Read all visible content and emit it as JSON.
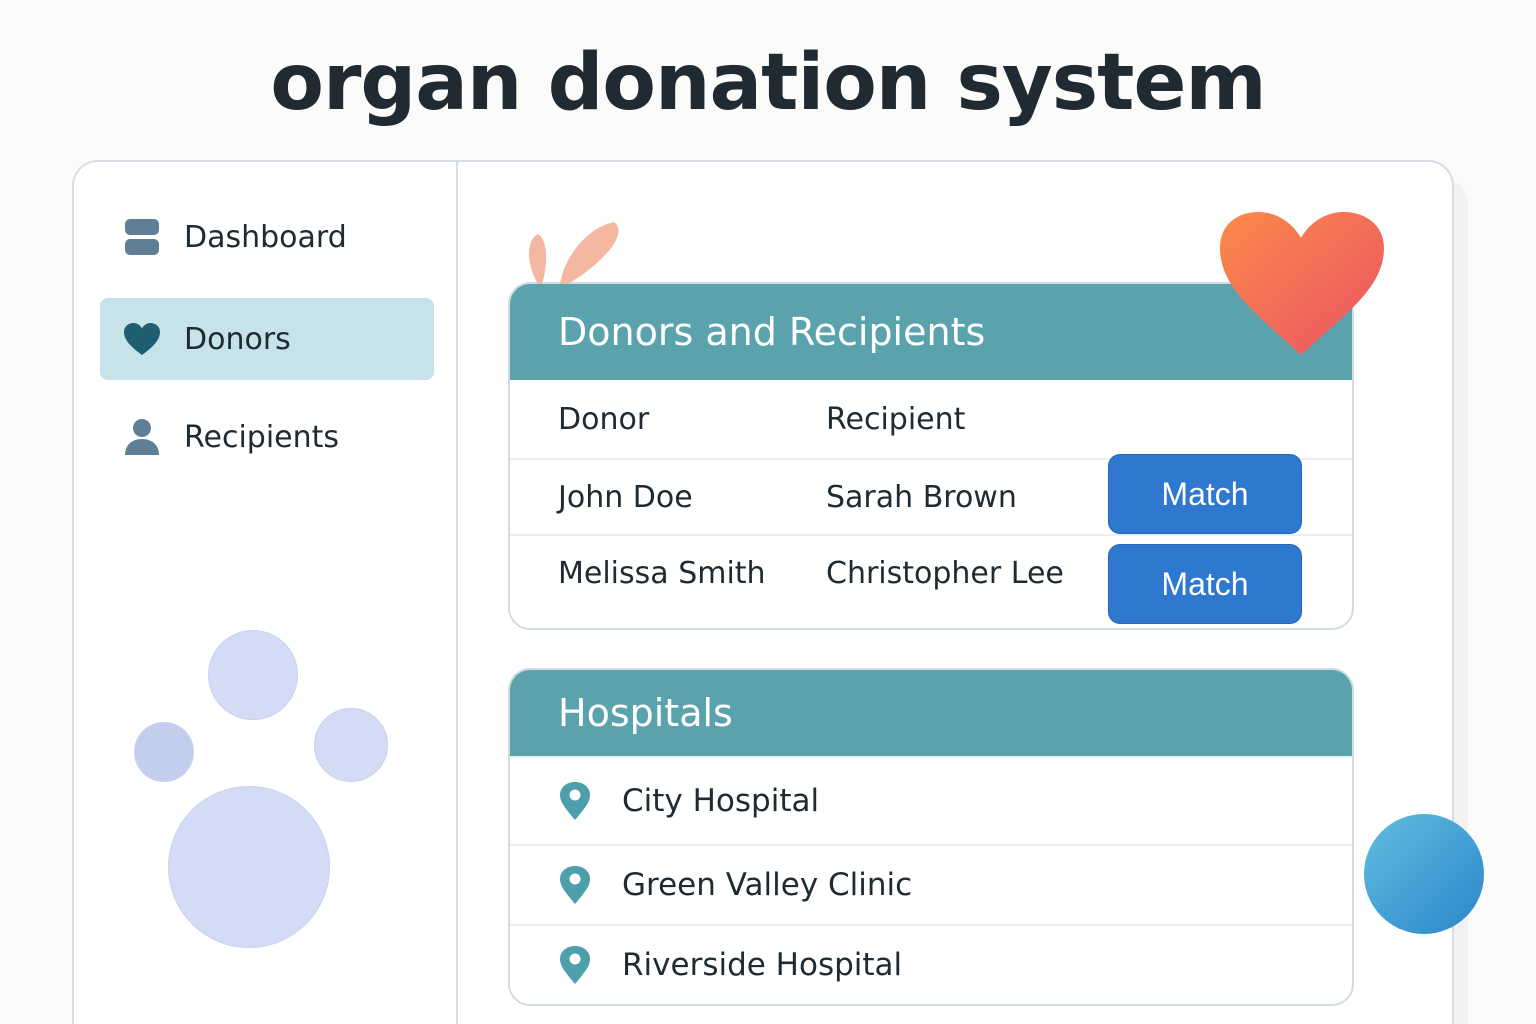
{
  "app": {
    "title": "organ donation system"
  },
  "sidebar": {
    "items": [
      {
        "label": "Dashboard",
        "icon": "dashboard-icon",
        "active": false
      },
      {
        "label": "Donors",
        "icon": "heart-icon",
        "active": true
      },
      {
        "label": "Recipients",
        "icon": "person-icon",
        "active": false
      }
    ]
  },
  "donors_card": {
    "title": "Donors and Recipients",
    "columns": {
      "donor": "Donor",
      "recipient": "Recipient"
    },
    "rows": [
      {
        "donor": "John Doe",
        "recipient": "Sarah Brown",
        "action": "Match"
      },
      {
        "donor": "Melissa Smith",
        "recipient": "Christopher Lee",
        "action": "Match"
      }
    ]
  },
  "hospitals_card": {
    "title": "Hospitals",
    "items": [
      {
        "name": "City Hospital",
        "icon": "location-pin-icon"
      },
      {
        "name": "Green Valley Clinic",
        "icon": "location-pin-icon"
      },
      {
        "name": "Riverside Hospital",
        "icon": "location-pin-icon"
      }
    ]
  },
  "colors": {
    "header_teal": "#5aa3ad",
    "active_nav": "#c5e3e8",
    "button_blue": "#2f78d0",
    "heart": "#f0605f",
    "text": "#1f2a33"
  }
}
